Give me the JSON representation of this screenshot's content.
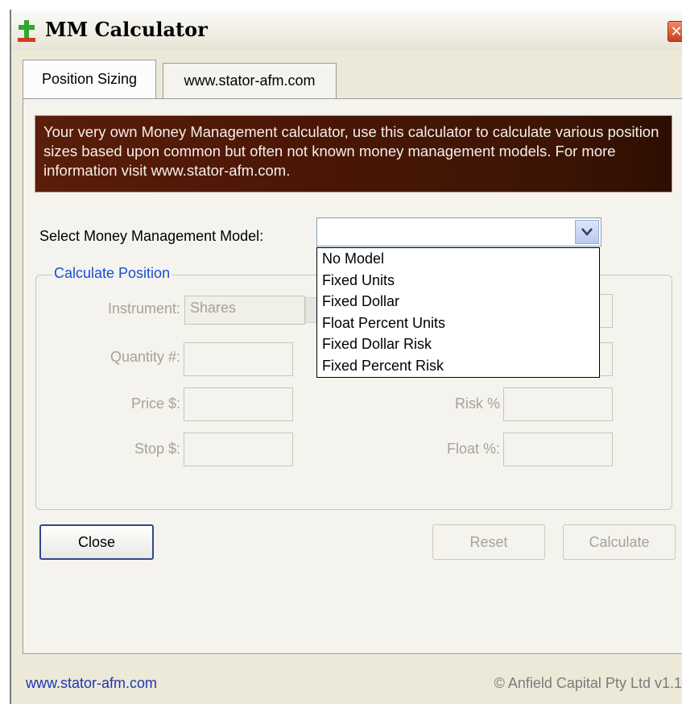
{
  "window": {
    "title": "MM Calculator",
    "close_glyph": "✕",
    "icon": "green-cross-app-icon"
  },
  "tabs": [
    {
      "label": "Position Sizing",
      "active": true
    },
    {
      "label": "www.stator-afm.com",
      "active": false
    }
  ],
  "banner": {
    "text": "Your very own Money Management calculator, use this calculator to calculate various position sizes based upon common but often not known money management models. For more information visit www.stator-afm.com."
  },
  "model_select": {
    "label": "Select Money Management Model:",
    "value": "",
    "options": [
      "No Model",
      "Fixed Units",
      "Fixed Dollar",
      "Float Percent Units",
      "Fixed Dollar Risk",
      "Fixed Percent Risk"
    ]
  },
  "calculate_position": {
    "title": "Calculate Position",
    "instrument_label": "Instrument:",
    "instrument_value": "Shares",
    "quantity_label": "Quantity #:",
    "price_label": "Price $:",
    "stop_label": "Stop $:",
    "risk_label": "Risk %",
    "float_label": "Float %:"
  },
  "buttons": {
    "close": "Close",
    "reset": "Reset",
    "calculate": "Calculate"
  },
  "footer": {
    "link": "www.stator-afm.com",
    "copyright": "© Anfield Capital Pty Ltd v1.1"
  },
  "colors": {
    "banner_bg": "#4a1606",
    "group_title": "#1a4fd1",
    "footer_link": "#1c36b3"
  }
}
